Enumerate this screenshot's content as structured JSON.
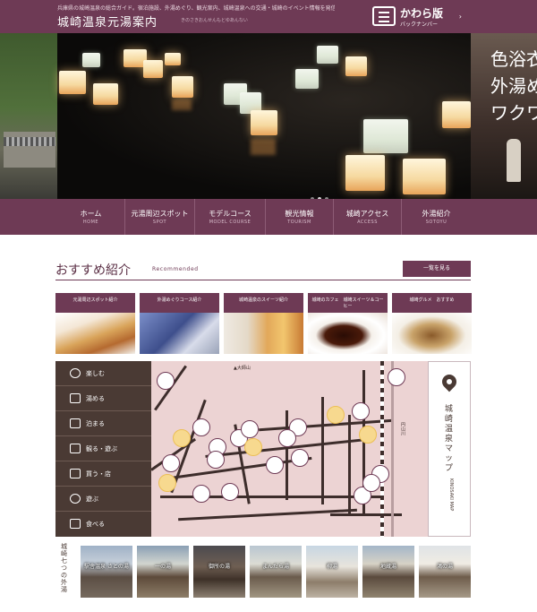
{
  "header": {
    "tagline": "兵庫県の城崎温泉の総合ガイド。宿泊施設、外湯めぐり、観光案内、城崎温泉への交通・城崎のイベント情報を発信",
    "title": "城崎温泉元湯案内",
    "subtitle": "きのさきおんせんもとゆあんない",
    "backnumber_title": "かわら版",
    "backnumber_sub": "バックナンバー",
    "backnumber_arrow": "›"
  },
  "hero": {
    "right_copy": [
      "色浴衣",
      "外湯め",
      "ワクワ"
    ],
    "slides": 3,
    "active_slide": 1
  },
  "nav": [
    {
      "jp": "ホーム",
      "en": "HOME"
    },
    {
      "jp": "元湯周辺スポット",
      "en": "SPOT"
    },
    {
      "jp": "モデルコース",
      "en": "MODEL COURSE"
    },
    {
      "jp": "観光情報",
      "en": "TOURISM"
    },
    {
      "jp": "城崎アクセス",
      "en": "ACCESS"
    },
    {
      "jp": "外湯紹介",
      "en": "SOTOYU"
    }
  ],
  "recommend": {
    "title": "おすすめ紹介",
    "title_en": "Recommended",
    "more_label": "一覧を見る",
    "cards": [
      {
        "label": "元湯周辺スポット紹介"
      },
      {
        "label": "外湯めぐりコース紹介"
      },
      {
        "label": "城崎温泉のスイーツ紹介"
      },
      {
        "label": "城崎のカフェ　城崎スイーツ＆コーヒー"
      },
      {
        "label": "城崎グルメ　おすすめ"
      }
    ]
  },
  "map": {
    "menu": [
      {
        "label": "楽しむ",
        "icon": "smile-icon"
      },
      {
        "label": "湯める",
        "icon": "onsen-icon"
      },
      {
        "label": "泊まる",
        "icon": "bed-icon"
      },
      {
        "label": "観る・遊ぶ",
        "icon": "camera-icon"
      },
      {
        "label": "買う・店",
        "icon": "shop-icon"
      },
      {
        "label": "遊ぶ",
        "icon": "binoculars-icon"
      },
      {
        "label": "食べる",
        "icon": "food-icon"
      }
    ],
    "side_title": "城崎温泉マップ",
    "side_sub": "KINOSAKI MAP",
    "labels": {
      "river": "円山川",
      "mountain": "▲大師山"
    }
  },
  "baths": {
    "label": "城崎七つの外湯",
    "items": [
      {
        "name": "駅舎温泉 さとの湯"
      },
      {
        "name": "一の湯"
      },
      {
        "name": "御所の湯"
      },
      {
        "name": "まんだら湯"
      },
      {
        "name": "柳湯"
      },
      {
        "name": "地蔵湯"
      },
      {
        "name": "鴻の湯"
      }
    ]
  },
  "colors": {
    "brand": "#6e3a55",
    "map_bg": "#ecd3d3",
    "menu_bg": "#4a3a34",
    "smile_pin": "#f7d98f"
  }
}
